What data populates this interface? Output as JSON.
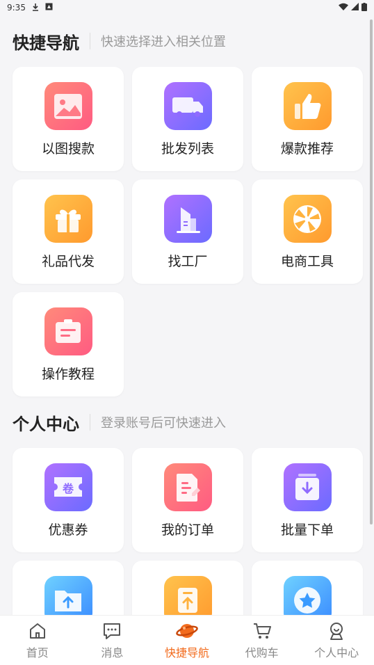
{
  "status_bar": {
    "time": "9:35"
  },
  "sections": [
    {
      "title": "快捷导航",
      "subtitle": "快速选择进入相关位置",
      "items": [
        {
          "label": "以图搜款",
          "icon": "image-icon"
        },
        {
          "label": "批发列表",
          "icon": "truck-icon"
        },
        {
          "label": "爆款推荐",
          "icon": "thumbs-up-icon"
        },
        {
          "label": "礼品代发",
          "icon": "gift-icon"
        },
        {
          "label": "找工厂",
          "icon": "factory-icon"
        },
        {
          "label": "电商工具",
          "icon": "wheel-icon"
        },
        {
          "label": "操作教程",
          "icon": "tutorial-icon"
        }
      ]
    },
    {
      "title": "个人中心",
      "subtitle": "登录账号后可快速进入",
      "items": [
        {
          "label": "优惠券",
          "icon": "coupon-icon",
          "badge": "卷"
        },
        {
          "label": "我的订单",
          "icon": "order-icon"
        },
        {
          "label": "批量下单",
          "icon": "batch-order-icon"
        },
        {
          "label": "",
          "icon": "upload-folder-icon"
        },
        {
          "label": "",
          "icon": "upload-file-icon"
        },
        {
          "label": "",
          "icon": "star-icon"
        }
      ]
    }
  ],
  "tabbar": {
    "items": [
      {
        "label": "首页",
        "icon": "home-icon",
        "active": false
      },
      {
        "label": "消息",
        "icon": "message-icon",
        "active": false
      },
      {
        "label": "快捷导航",
        "icon": "planet-icon",
        "active": true
      },
      {
        "label": "代购车",
        "icon": "cart-icon",
        "active": false
      },
      {
        "label": "个人中心",
        "icon": "user-icon",
        "active": false
      }
    ]
  },
  "colors": {
    "accent": "#f26b1d",
    "background": "#f5f5f7"
  }
}
